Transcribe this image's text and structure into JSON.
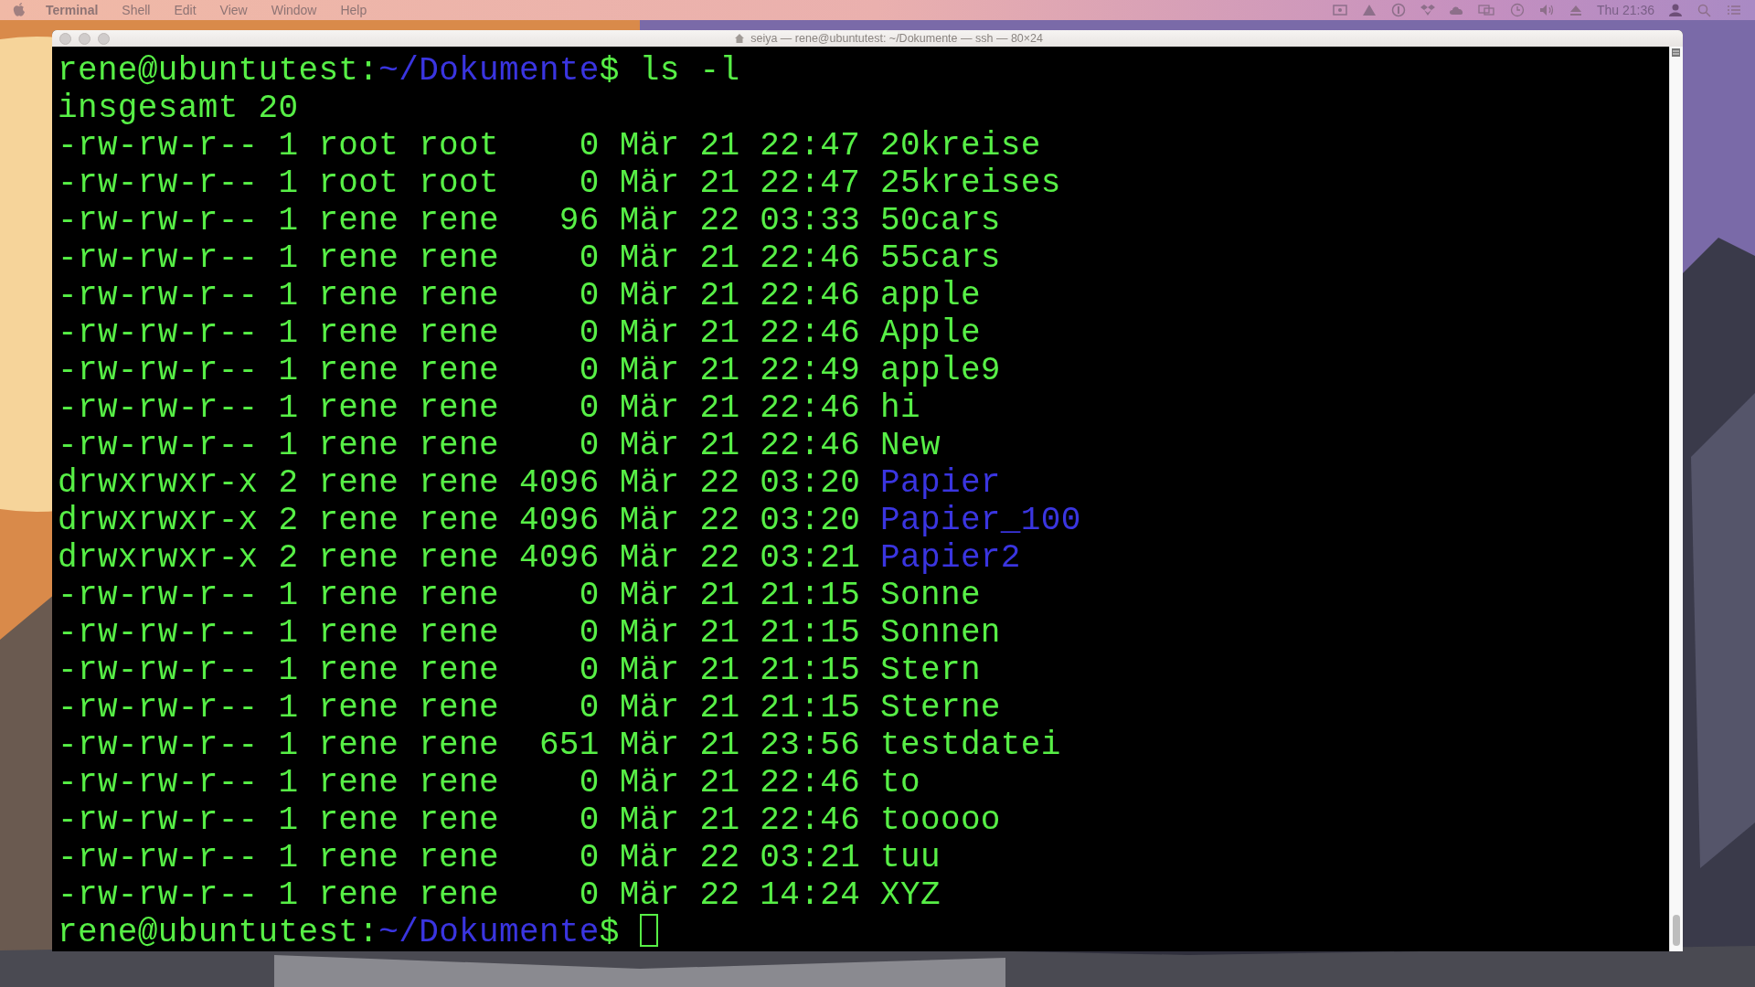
{
  "menu_bar": {
    "menus": [
      "Terminal",
      "Shell",
      "Edit",
      "View",
      "Window",
      "Help"
    ],
    "clock": "Thu 21:36"
  },
  "window": {
    "title": "seiya — rene@ubuntutest: ~/Dokumente — ssh — 80×24",
    "lines": [
      {
        "kind": "prompt",
        "user_host": "rene@ubuntutest:",
        "path": "~/Dokumente",
        "command": "$ ls -l",
        "cursor": false
      },
      {
        "kind": "text",
        "text": "insgesamt 20"
      },
      {
        "kind": "file",
        "info": "-rw-rw-r-- 1 root root    0 Mär 21 22:47 ",
        "name": "20kreise"
      },
      {
        "kind": "file",
        "info": "-rw-rw-r-- 1 root root    0 Mär 21 22:47 ",
        "name": "25kreises"
      },
      {
        "kind": "file",
        "info": "-rw-rw-r-- 1 rene rene   96 Mär 22 03:33 ",
        "name": "50cars"
      },
      {
        "kind": "file",
        "info": "-rw-rw-r-- 1 rene rene    0 Mär 21 22:46 ",
        "name": "55cars"
      },
      {
        "kind": "file",
        "info": "-rw-rw-r-- 1 rene rene    0 Mär 21 22:46 ",
        "name": "apple"
      },
      {
        "kind": "file",
        "info": "-rw-rw-r-- 1 rene rene    0 Mär 21 22:46 ",
        "name": "Apple"
      },
      {
        "kind": "file",
        "info": "-rw-rw-r-- 1 rene rene    0 Mär 21 22:49 ",
        "name": "apple9"
      },
      {
        "kind": "file",
        "info": "-rw-rw-r-- 1 rene rene    0 Mär 21 22:46 ",
        "name": "hi"
      },
      {
        "kind": "file",
        "info": "-rw-rw-r-- 1 rene rene    0 Mär 21 22:46 ",
        "name": "New"
      },
      {
        "kind": "dir",
        "info": "drwxrwxr-x 2 rene rene 4096 Mär 22 03:20 ",
        "name": "Papier"
      },
      {
        "kind": "dir",
        "info": "drwxrwxr-x 2 rene rene 4096 Mär 22 03:20 ",
        "name": "Papier_100"
      },
      {
        "kind": "dir",
        "info": "drwxrwxr-x 2 rene rene 4096 Mär 22 03:21 ",
        "name": "Papier2"
      },
      {
        "kind": "file",
        "info": "-rw-rw-r-- 1 rene rene    0 Mär 21 21:15 ",
        "name": "Sonne"
      },
      {
        "kind": "file",
        "info": "-rw-rw-r-- 1 rene rene    0 Mär 21 21:15 ",
        "name": "Sonnen"
      },
      {
        "kind": "file",
        "info": "-rw-rw-r-- 1 rene rene    0 Mär 21 21:15 ",
        "name": "Stern"
      },
      {
        "kind": "file",
        "info": "-rw-rw-r-- 1 rene rene    0 Mär 21 21:15 ",
        "name": "Sterne"
      },
      {
        "kind": "file",
        "info": "-rw-rw-r-- 1 rene rene  651 Mär 21 23:56 ",
        "name": "testdatei"
      },
      {
        "kind": "file",
        "info": "-rw-rw-r-- 1 rene rene    0 Mär 21 22:46 ",
        "name": "to"
      },
      {
        "kind": "file",
        "info": "-rw-rw-r-- 1 rene rene    0 Mär 21 22:46 ",
        "name": "tooooo"
      },
      {
        "kind": "file",
        "info": "-rw-rw-r-- 1 rene rene    0 Mär 22 03:21 ",
        "name": "tuu"
      },
      {
        "kind": "file",
        "info": "-rw-rw-r-- 1 rene rene    0 Mär 22 14:24 ",
        "name": "XYZ"
      },
      {
        "kind": "prompt",
        "user_host": "rene@ubuntutest:",
        "path": "~/Dokumente",
        "command": "$ ",
        "cursor": true
      }
    ]
  }
}
